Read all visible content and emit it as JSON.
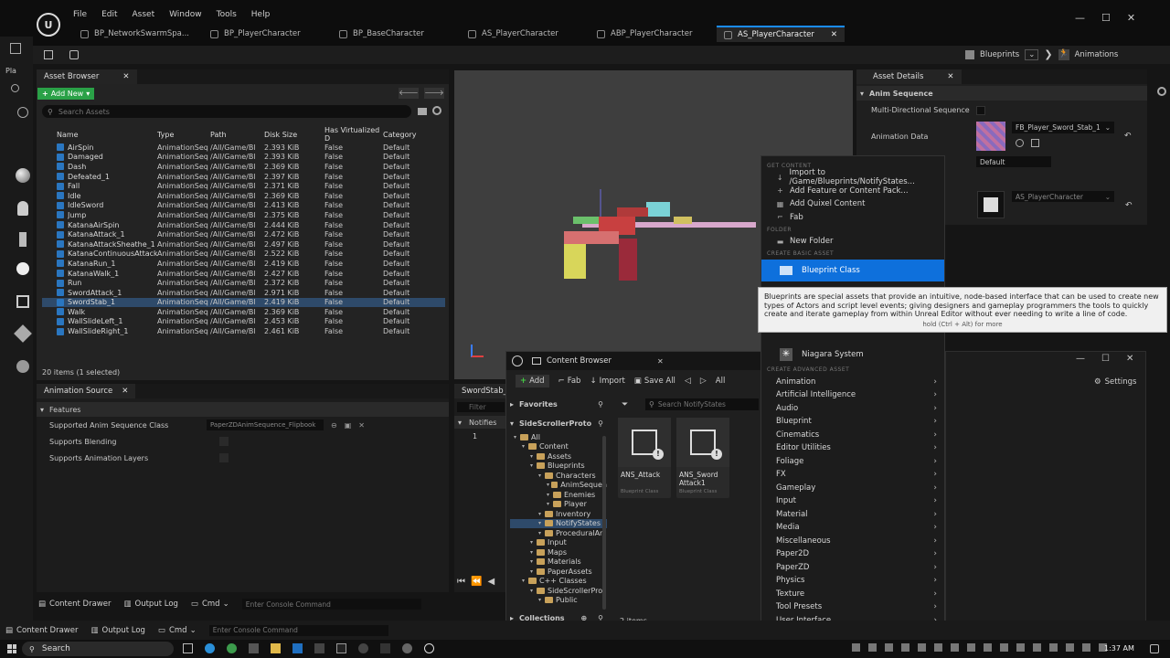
{
  "menu": [
    "File",
    "Edit",
    "Asset",
    "Window",
    "Tools",
    "Help"
  ],
  "tabs": [
    {
      "label": "BP_NetworkSwarmSpa..."
    },
    {
      "label": "BP_PlayerCharacter"
    },
    {
      "label": "BP_BaseCharacter"
    },
    {
      "label": "AS_PlayerCharacter"
    },
    {
      "label": "ABP_PlayerCharacter"
    },
    {
      "label": "AS_PlayerCharacter",
      "active": true
    }
  ],
  "modes": {
    "blueprints": "Blueprints",
    "animations": "Animations"
  },
  "left_rail_label": "Pla",
  "asset_browser": {
    "title": "Asset Browser",
    "add_new": "Add New",
    "search_placeholder": "Search Assets",
    "columns": [
      "Name",
      "Type",
      "Path",
      "Disk Size",
      "Has Virtualized D",
      "Category"
    ],
    "rows": [
      {
        "name": "AirSpin",
        "type": "AnimationSeq",
        "path": "/All/Game/Bl",
        "size": "2.393 KiB",
        "virt": "False",
        "cat": "Default"
      },
      {
        "name": "Damaged",
        "type": "AnimationSeq",
        "path": "/All/Game/Bl",
        "size": "2.393 KiB",
        "virt": "False",
        "cat": "Default"
      },
      {
        "name": "Dash",
        "type": "AnimationSeq",
        "path": "/All/Game/Bl",
        "size": "2.369 KiB",
        "virt": "False",
        "cat": "Default"
      },
      {
        "name": "Defeated_1",
        "type": "AnimationSeq",
        "path": "/All/Game/Bl",
        "size": "2.397 KiB",
        "virt": "False",
        "cat": "Default"
      },
      {
        "name": "Fall",
        "type": "AnimationSeq",
        "path": "/All/Game/Bl",
        "size": "2.371 KiB",
        "virt": "False",
        "cat": "Default"
      },
      {
        "name": "Idle",
        "type": "AnimationSeq",
        "path": "/All/Game/Bl",
        "size": "2.369 KiB",
        "virt": "False",
        "cat": "Default"
      },
      {
        "name": "IdleSword",
        "type": "AnimationSeq",
        "path": "/All/Game/Bl",
        "size": "2.413 KiB",
        "virt": "False",
        "cat": "Default"
      },
      {
        "name": "Jump",
        "type": "AnimationSeq",
        "path": "/All/Game/Bl",
        "size": "2.375 KiB",
        "virt": "False",
        "cat": "Default"
      },
      {
        "name": "KatanaAirSpin",
        "type": "AnimationSeq",
        "path": "/All/Game/Bl",
        "size": "2.444 KiB",
        "virt": "False",
        "cat": "Default"
      },
      {
        "name": "KatanaAttack_1",
        "type": "AnimationSeq",
        "path": "/All/Game/Bl",
        "size": "2.472 KiB",
        "virt": "False",
        "cat": "Default"
      },
      {
        "name": "KatanaAttackSheathe_1",
        "type": "AnimationSeq",
        "path": "/All/Game/Bl",
        "size": "2.497 KiB",
        "virt": "False",
        "cat": "Default"
      },
      {
        "name": "KatanaContinuousAttack",
        "type": "AnimationSeq",
        "path": "/All/Game/Bl",
        "size": "2.522 KiB",
        "virt": "False",
        "cat": "Default"
      },
      {
        "name": "KatanaRun_1",
        "type": "AnimationSeq",
        "path": "/All/Game/Bl",
        "size": "2.419 KiB",
        "virt": "False",
        "cat": "Default"
      },
      {
        "name": "KatanaWalk_1",
        "type": "AnimationSeq",
        "path": "/All/Game/Bl",
        "size": "2.427 KiB",
        "virt": "False",
        "cat": "Default"
      },
      {
        "name": "Run",
        "type": "AnimationSeq",
        "path": "/All/Game/Bl",
        "size": "2.372 KiB",
        "virt": "False",
        "cat": "Default"
      },
      {
        "name": "SwordAttack_1",
        "type": "AnimationSeq",
        "path": "/All/Game/Bl",
        "size": "2.971 KiB",
        "virt": "False",
        "cat": "Default"
      },
      {
        "name": "SwordStab_1",
        "type": "AnimationSeq",
        "path": "/All/Game/Bl",
        "size": "2.419 KiB",
        "virt": "False",
        "cat": "Default",
        "selected": true
      },
      {
        "name": "Walk",
        "type": "AnimationSeq",
        "path": "/All/Game/Bl",
        "size": "2.369 KiB",
        "virt": "False",
        "cat": "Default"
      },
      {
        "name": "WallSlideLeft_1",
        "type": "AnimationSeq",
        "path": "/All/Game/Bl",
        "size": "2.453 KiB",
        "virt": "False",
        "cat": "Default"
      },
      {
        "name": "WallSlideRight_1",
        "type": "AnimationSeq",
        "path": "/All/Game/Bl",
        "size": "2.461 KiB",
        "virt": "False",
        "cat": "Default"
      }
    ],
    "status": "20 items (1 selected)"
  },
  "anim_source": {
    "title": "Animation Source",
    "section": "Features",
    "props": [
      {
        "label": "Supported Anim Sequence Class",
        "value": "PaperZDAnimSequence_Flipbook"
      },
      {
        "label": "Supports Blending",
        "value": ""
      },
      {
        "label": "Supports Animation Layers",
        "value": ""
      }
    ]
  },
  "asset_details": {
    "title": "Asset Details",
    "section": "Anim Sequence",
    "multi_dir": "Multi-Directional Sequence",
    "anim_data": "Animation Data",
    "anim_data_value": "FB_Player_Sword_Stab_1",
    "default_label": "Default",
    "anim_source_value": "AS_PlayerCharacter"
  },
  "notify_panel": {
    "tab": "SwordStab_1",
    "filter": "Filter",
    "notifies": "Notifies",
    "track": "1"
  },
  "context_menu": {
    "sections": [
      {
        "header": "GET CONTENT",
        "items": [
          {
            "label": "Import to /Game/Blueprints/NotifyStates...",
            "icon": "↓"
          },
          {
            "label": "Add Feature or Content Pack...",
            "icon": "+"
          },
          {
            "label": "Add Quixel Content",
            "icon": "▦"
          },
          {
            "label": "Fab",
            "icon": "⌐"
          }
        ]
      },
      {
        "header": "FOLDER",
        "items": [
          {
            "label": "New Folder",
            "icon": "▬"
          }
        ]
      },
      {
        "header": "CREATE BASIC ASSET",
        "items": []
      }
    ],
    "blueprint_class": "Blueprint Class",
    "niagara": "Niagara System",
    "advanced_header": "CREATE ADVANCED ASSET",
    "advanced_items": [
      "Animation",
      "Artificial Intelligence",
      "Audio",
      "Blueprint",
      "Cinematics",
      "Editor Utilities",
      "Foliage",
      "FX",
      "Gameplay",
      "Input",
      "Material",
      "Media",
      "Miscellaneous",
      "Paper2D",
      "PaperZD",
      "Physics",
      "Texture",
      "Tool Presets",
      "User Interface"
    ]
  },
  "tooltip": {
    "text": "Blueprints are special assets that provide an intuitive, node-based interface that can be used to create new types of Actors and script level events; giving designers and gameplay programmers the tools to quickly create and iterate gameplay from within Unreal Editor without ever needing to write a line of code.",
    "hint": "hold (Ctrl + Alt) for more"
  },
  "content_browser": {
    "title": "Content Browser",
    "add": "Add",
    "fab": "Fab",
    "import": "Import",
    "save_all": "Save All",
    "all": "All",
    "favorites": "Favorites",
    "project": "SideScrollerProto",
    "search_placeholder": "Search NotifyStates",
    "tree": [
      {
        "label": "All",
        "depth": 0
      },
      {
        "label": "Content",
        "depth": 1
      },
      {
        "label": "Assets",
        "depth": 2
      },
      {
        "label": "Blueprints",
        "depth": 2
      },
      {
        "label": "Characters",
        "depth": 3
      },
      {
        "label": "AnimSequen",
        "depth": 4
      },
      {
        "label": "Enemies",
        "depth": 4
      },
      {
        "label": "Player",
        "depth": 4
      },
      {
        "label": "Inventory",
        "depth": 3
      },
      {
        "label": "NotifyStates",
        "depth": 3,
        "selected": true
      },
      {
        "label": "ProceduralAni",
        "depth": 3
      },
      {
        "label": "Input",
        "depth": 2
      },
      {
        "label": "Maps",
        "depth": 2
      },
      {
        "label": "Materials",
        "depth": 2
      },
      {
        "label": "PaperAssets",
        "depth": 2
      },
      {
        "label": "C++ Classes",
        "depth": 1
      },
      {
        "label": "SideScrollerProt",
        "depth": 2
      },
      {
        "label": "Public",
        "depth": 3
      }
    ],
    "assets": [
      {
        "name": "ANS_Attack",
        "kind": "Blueprint Class"
      },
      {
        "name": "ANS_Sword Attack1",
        "kind": "Blueprint Class"
      }
    ],
    "collections": "Collections",
    "count": "2 items"
  },
  "settings": "Settings",
  "bottom": {
    "content_drawer": "Content Drawer",
    "output_log": "Output Log",
    "cmd": "Cmd",
    "console_placeholder": "Enter Console Command"
  },
  "taskbar": {
    "search": "Search",
    "time": "1:37 AM"
  }
}
